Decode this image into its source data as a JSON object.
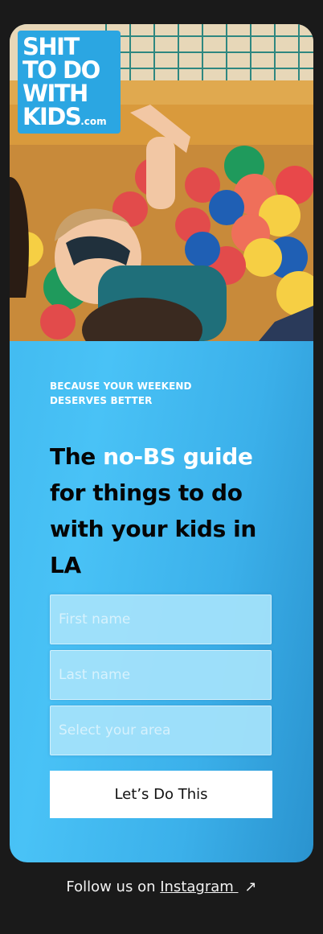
{
  "logo": {
    "line1": "SHIT",
    "line2": "TO DO",
    "line3": "WITH",
    "line4": "KIDS",
    "suffix": ".com"
  },
  "hero": {
    "eyebrow_line1": "BECAUSE YOUR WEEKEND",
    "eyebrow_line2": "DESERVES BETTER",
    "headline_pre": "The ",
    "headline_accent": "no-BS guide",
    "headline_post": " for things to do with your kids in LA"
  },
  "form": {
    "first_name_placeholder": "First name",
    "last_name_placeholder": "Last name",
    "area_placeholder": "Select your area",
    "submit_label": "Let’s Do This"
  },
  "footer": {
    "prefix": "Follow us on ",
    "link_label": "Instagram ",
    "arrow_icon": "arrow-up-right-icon"
  },
  "colors": {
    "page_bg": "#1a1a1a",
    "card_blue": "#45bff4",
    "logo_blue": "#2ba6e2",
    "button_bg": "#ffffff"
  }
}
